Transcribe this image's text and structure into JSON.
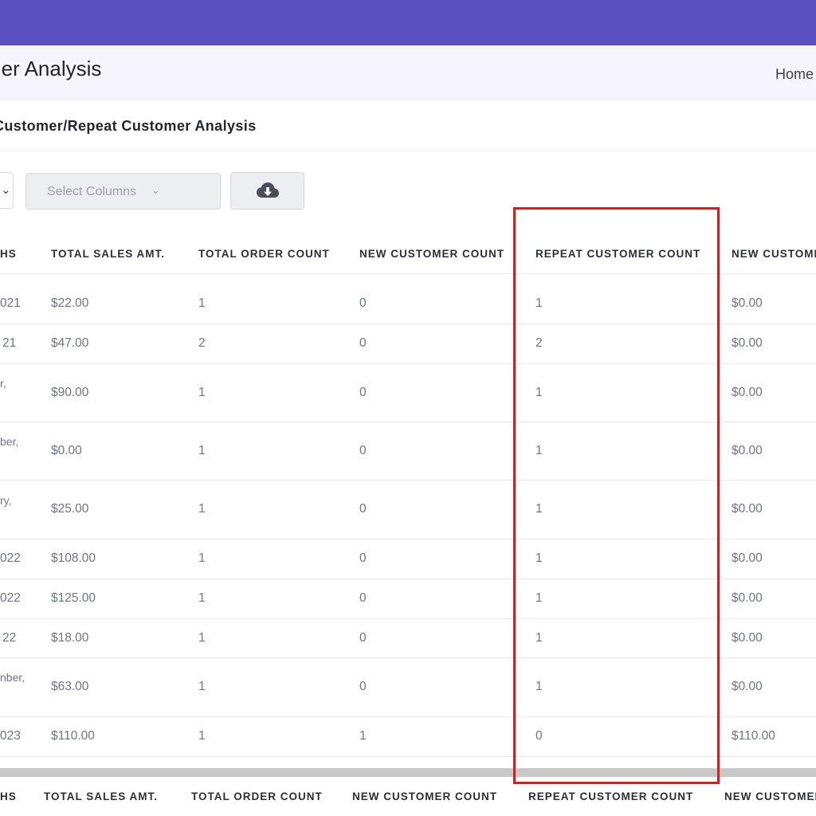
{
  "header": {
    "page_title": "Customer Analysis",
    "page_title_visible": "mer Analysis",
    "breadcrumb_home": "Home"
  },
  "card": {
    "title": "Customer/Repeat Customer Analysis"
  },
  "toolbar": {
    "columns_placeholder": "Select Columns",
    "download_icon": "cloud-download-icon"
  },
  "table": {
    "columns": [
      "HS",
      "TOTAL SALES AMT.",
      "TOTAL ORDER COUNT",
      "NEW CUSTOMER COUNT",
      "REPEAT CUSTOMER COUNT",
      "NEW CUSTOMI"
    ],
    "footer_columns": [
      "HS",
      "TOTAL SALES AMT.",
      "TOTAL ORDER COUNT",
      "NEW CUSTOMER COUNT",
      "REPEAT CUSTOMER COUNT",
      "NEW CUSTOMER"
    ],
    "rows": [
      {
        "month": "021",
        "sales": "$22.00",
        "orders": "1",
        "new": "0",
        "repeat": "1",
        "new_amt": "$0.00"
      },
      {
        "month": "21",
        "sales": "$47.00",
        "orders": "2",
        "new": "0",
        "repeat": "2",
        "new_amt": "$0.00"
      },
      {
        "month": "r,",
        "sales": "$90.00",
        "orders": "1",
        "new": "0",
        "repeat": "1",
        "new_amt": "$0.00"
      },
      {
        "month": "ber,",
        "sales": "$0.00",
        "orders": "1",
        "new": "0",
        "repeat": "1",
        "new_amt": "$0.00"
      },
      {
        "month": "ry,",
        "sales": "$25.00",
        "orders": "1",
        "new": "0",
        "repeat": "1",
        "new_amt": "$0.00"
      },
      {
        "month": "022",
        "sales": "$108.00",
        "orders": "1",
        "new": "0",
        "repeat": "1",
        "new_amt": "$0.00"
      },
      {
        "month": "022",
        "sales": "$125.00",
        "orders": "1",
        "new": "0",
        "repeat": "1",
        "new_amt": "$0.00"
      },
      {
        "month": "22",
        "sales": "$18.00",
        "orders": "1",
        "new": "0",
        "repeat": "1",
        "new_amt": "$0.00"
      },
      {
        "month": "nber,",
        "sales": "$63.00",
        "orders": "1",
        "new": "0",
        "repeat": "1",
        "new_amt": "$0.00"
      },
      {
        "month": "023",
        "sales": "$110.00",
        "orders": "1",
        "new": "1",
        "repeat": "0",
        "new_amt": "$110.00"
      }
    ]
  },
  "colors": {
    "topbar": "#5a50c0",
    "header_bg": "#f6f4fc",
    "highlight": "#e01919"
  }
}
